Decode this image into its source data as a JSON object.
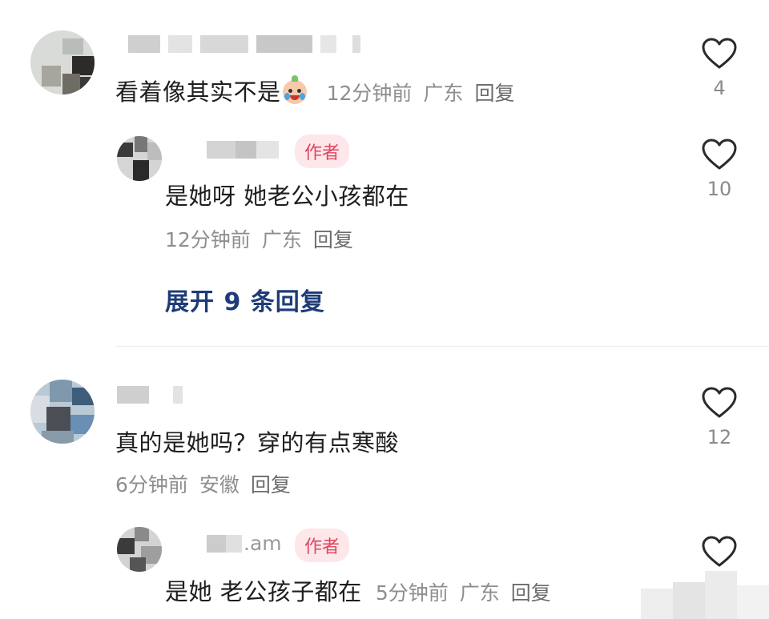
{
  "comments": [
    {
      "text": "看着像其实不是",
      "emoji": "crying-baby-emoji",
      "time": "12分钟前",
      "region": "广东",
      "reply": "回复",
      "likes": "4",
      "replies": [
        {
          "badge": "作者",
          "text": "是她呀 她老公小孩都在",
          "time": "12分钟前",
          "region": "广东",
          "reply": "回复",
          "likes": "10"
        }
      ],
      "expand": "展开 9 条回复"
    },
    {
      "text": "真的是她吗？穿的有点寒酸",
      "time": "6分钟前",
      "region": "安徽",
      "reply": "回复",
      "likes": "12",
      "replies": [
        {
          "name_fragment": ".am",
          "badge": "作者",
          "text": "是她 老公孩子都在",
          "time": "5分钟前",
          "region": "广东",
          "reply": "回复"
        }
      ]
    }
  ],
  "colors": {
    "author_badge_bg": "#fde7ea",
    "author_badge_text": "#e0455e",
    "expand_link": "#1e3c78",
    "meta_gray": "#8e8e8e"
  },
  "icons": [
    "heart-outline-icon"
  ]
}
